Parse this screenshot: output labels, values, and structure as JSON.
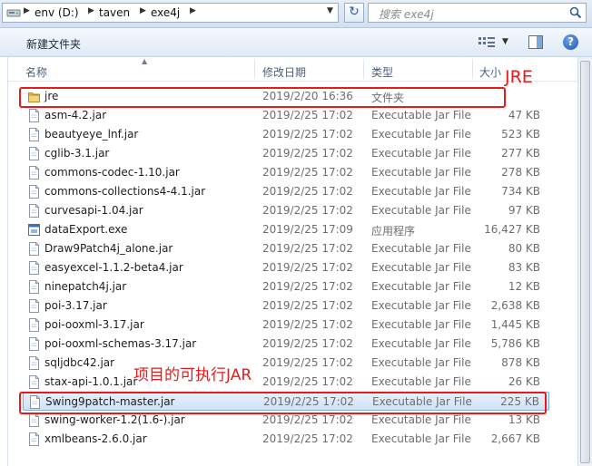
{
  "address": {
    "crumbs": [
      "env (D:)",
      "taven",
      "exe4j"
    ],
    "search_placeholder": "搜索 exe4j"
  },
  "toolbar": {
    "new_folder_label": "新建文件夹"
  },
  "columns": {
    "name": "名称",
    "date": "修改日期",
    "type": "类型",
    "size": "大小"
  },
  "files": [
    {
      "name": "jre",
      "date": "2019/2/20 16:36",
      "type": "文件夹",
      "size": "",
      "icon": "folder-icon"
    },
    {
      "name": "asm-4.2.jar",
      "date": "2019/2/25 17:02",
      "type": "Executable Jar File",
      "size": "47 KB",
      "icon": "jar-file-icon"
    },
    {
      "name": "beautyeye_lnf.jar",
      "date": "2019/2/25 17:02",
      "type": "Executable Jar File",
      "size": "523 KB",
      "icon": "jar-file-icon"
    },
    {
      "name": "cglib-3.1.jar",
      "date": "2019/2/25 17:02",
      "type": "Executable Jar File",
      "size": "277 KB",
      "icon": "jar-file-icon"
    },
    {
      "name": "commons-codec-1.10.jar",
      "date": "2019/2/25 17:02",
      "type": "Executable Jar File",
      "size": "278 KB",
      "icon": "jar-file-icon"
    },
    {
      "name": "commons-collections4-4.1.jar",
      "date": "2019/2/25 17:02",
      "type": "Executable Jar File",
      "size": "734 KB",
      "icon": "jar-file-icon"
    },
    {
      "name": "curvesapi-1.04.jar",
      "date": "2019/2/25 17:02",
      "type": "Executable Jar File",
      "size": "97 KB",
      "icon": "jar-file-icon"
    },
    {
      "name": "dataExport.exe",
      "date": "2019/2/25 17:09",
      "type": "应用程序",
      "size": "16,427 KB",
      "icon": "exe-file-icon"
    },
    {
      "name": "Draw9Patch4j_alone.jar",
      "date": "2019/2/25 17:02",
      "type": "Executable Jar File",
      "size": "80 KB",
      "icon": "jar-file-icon"
    },
    {
      "name": "easyexcel-1.1.2-beta4.jar",
      "date": "2019/2/25 17:02",
      "type": "Executable Jar File",
      "size": "83 KB",
      "icon": "jar-file-icon"
    },
    {
      "name": "ninepatch4j.jar",
      "date": "2019/2/25 17:02",
      "type": "Executable Jar File",
      "size": "12 KB",
      "icon": "jar-file-icon"
    },
    {
      "name": "poi-3.17.jar",
      "date": "2019/2/25 17:02",
      "type": "Executable Jar File",
      "size": "2,638 KB",
      "icon": "jar-file-icon"
    },
    {
      "name": "poi-ooxml-3.17.jar",
      "date": "2019/2/25 17:02",
      "type": "Executable Jar File",
      "size": "1,445 KB",
      "icon": "jar-file-icon"
    },
    {
      "name": "poi-ooxml-schemas-3.17.jar",
      "date": "2019/2/25 17:02",
      "type": "Executable Jar File",
      "size": "5,786 KB",
      "icon": "jar-file-icon"
    },
    {
      "name": "sqljdbc42.jar",
      "date": "2019/2/25 17:02",
      "type": "Executable Jar File",
      "size": "878 KB",
      "icon": "jar-file-icon"
    },
    {
      "name": "stax-api-1.0.1.jar",
      "date": "2019/2/25 17:02",
      "type": "Executable Jar File",
      "size": "26 KB",
      "icon": "jar-file-icon"
    },
    {
      "name": "Swing9patch-master.jar",
      "date": "2019/2/25 17:02",
      "type": "Executable Jar File",
      "size": "225 KB",
      "icon": "jar-file-icon",
      "selected": true
    },
    {
      "name": "swing-worker-1.2(1.6-).jar",
      "date": "2019/2/25 17:02",
      "type": "Executable Jar File",
      "size": "13 KB",
      "icon": "jar-file-icon"
    },
    {
      "name": "xmlbeans-2.6.0.jar",
      "date": "2019/2/25 17:02",
      "type": "Executable Jar File",
      "size": "2,667 KB",
      "icon": "jar-file-icon"
    }
  ],
  "annotations": {
    "jre_label": "JRE",
    "jar_label": "项目的可执行JAR",
    "color": "#e81a1a"
  }
}
